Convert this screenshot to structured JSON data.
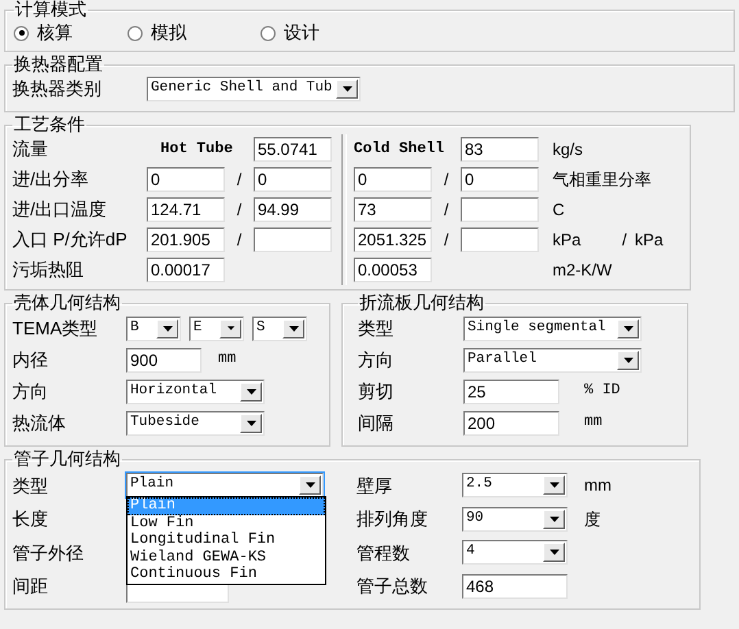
{
  "calc_mode": {
    "title": "计算模式",
    "options": [
      {
        "label": "核算",
        "selected": true
      },
      {
        "label": "模拟",
        "selected": false
      },
      {
        "label": "设计",
        "selected": false
      }
    ]
  },
  "exchanger_config": {
    "title": "换热器配置",
    "type_label": "换热器类别",
    "type_value": "Generic Shell and Tub"
  },
  "process": {
    "title": "工艺条件",
    "rows": [
      {
        "kind": "flow",
        "label": "流量",
        "hot_label": "Hot Tube",
        "hot_value": "55.0741",
        "cold_label": "Cold Shell",
        "cold_value": "83",
        "unit": "kg/s"
      },
      {
        "kind": "pair",
        "label": "进/出分率",
        "hot_in": "0",
        "hot_out": "0",
        "hot_sep": "/",
        "cold_in": "0",
        "cold_out": "0",
        "cold_sep": "/",
        "unit": "气相重里分率"
      },
      {
        "kind": "pair",
        "label": "进/出口温度",
        "hot_in": "124.71",
        "hot_out": "94.99",
        "hot_sep": "/",
        "cold_in": "73",
        "cold_sep": "/",
        "unit": "C"
      },
      {
        "kind": "pair",
        "label": "入口 P/允许dP",
        "hot_in": "201.905",
        "hot_sep": "/",
        "cold_in": "2051.325",
        "cold_sep": "/",
        "unit": "kPa",
        "unit_sep": "/",
        "unit_2": "kPa"
      },
      {
        "kind": "single",
        "label": "污垢热阻",
        "hot_value": "0.00017",
        "cold_value": "0.00053",
        "unit": "m2-K/W"
      }
    ]
  },
  "shell": {
    "title": "壳体几何结构",
    "rows": [
      {
        "kind": "tema",
        "label": "TEMA类型",
        "values": [
          "B",
          "E",
          "S"
        ]
      },
      {
        "kind": "field",
        "label": "内径",
        "value": "900",
        "unit": "mm"
      },
      {
        "kind": "select",
        "label": "方向",
        "value": "Horizontal"
      },
      {
        "kind": "select",
        "label": "热流体",
        "value": "Tubeside"
      }
    ]
  },
  "baffle": {
    "title": "折流板几何结构",
    "rows": [
      {
        "kind": "select",
        "label": "类型",
        "value": "Single segmental"
      },
      {
        "kind": "select",
        "label": "方向",
        "value": "Parallel"
      },
      {
        "kind": "field",
        "label": "剪切",
        "value": "25",
        "unit": "% ID"
      },
      {
        "kind": "field",
        "label": "间隔",
        "value": "200",
        "unit": "mm"
      }
    ]
  },
  "tube": {
    "title": "管子几何结构",
    "left_rows": [
      {
        "kind": "select",
        "label": "类型",
        "value": "Plain",
        "expanded": true,
        "options": [
          {
            "label": "Plain",
            "selected": true
          },
          {
            "label": "Low Fin",
            "selected": false
          },
          {
            "label": "Longitudinal Fin",
            "selected": false
          },
          {
            "label": "Wieland GEWA-KS",
            "selected": false
          },
          {
            "label": "Continuous Fin",
            "selected": false
          }
        ]
      },
      {
        "kind": "hidden",
        "label": "长度"
      },
      {
        "kind": "hidden",
        "label": "管子外径"
      },
      {
        "kind": "field",
        "label": "间距"
      }
    ],
    "right_rows": [
      {
        "kind": "select",
        "label": "壁厚",
        "value": "2.5",
        "unit": "mm"
      },
      {
        "kind": "select",
        "label": "排列角度",
        "value": "90",
        "unit": "度"
      },
      {
        "kind": "select",
        "label": "管程数",
        "value": "4"
      },
      {
        "kind": "field",
        "label": "管子总数",
        "value": "468"
      }
    ]
  }
}
